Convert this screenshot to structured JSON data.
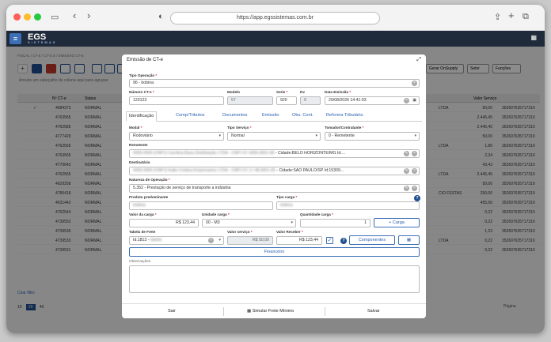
{
  "browser": {
    "url": "https://app.egssistemas.com.br"
  },
  "app": {
    "logo": "EGS",
    "logo_sub": "SISTEMAS"
  },
  "bg": {
    "breadcrumb": "FISCAL  /  CT-E / CT-E.S  /  EMISSÃO CT-E",
    "hint": "Arraste um cabeçalho de coluna aqui para agrupar",
    "cols": {
      "nct": "Nº CT-e",
      "status": "Status",
      "valor": "Valor Serviço"
    },
    "right_btns": {
      "onsupply": "Gerar OnSupply",
      "setor": "Setor",
      "funcoes": "Funções"
    },
    "rows": [
      {
        "n": "4684373",
        "s": "NORMAL",
        "c": "LTDA",
        "v": "50,00",
        "k": "352607635717310"
      },
      {
        "n": "4763565",
        "s": "NORMAL",
        "c": "",
        "v": "2.445,45",
        "k": "352607635717310"
      },
      {
        "n": "4762585",
        "s": "NORMAL",
        "c": "",
        "v": "2.445,45",
        "k": "352607635717310"
      },
      {
        "n": "4777429",
        "s": "NORMAL",
        "c": "",
        "v": "50,00",
        "k": "352607635717310"
      },
      {
        "n": "4762565",
        "s": "NORMAL",
        "c": "LTDA",
        "v": "1,80",
        "k": "352607635717310"
      },
      {
        "n": "4763565",
        "s": "NORMAL",
        "c": "",
        "v": "2,34",
        "k": "352607635717310"
      },
      {
        "n": "4770643",
        "s": "NORMAL",
        "c": "",
        "v": "43,43",
        "k": "352607635717310"
      },
      {
        "n": "4762565",
        "s": "NORMAL",
        "c": "LTDA",
        "v": "2.445,45",
        "k": "352607635717310"
      },
      {
        "n": "4629258",
        "s": "NORMAL",
        "c": "",
        "v": "50,00",
        "k": "352607635717310"
      },
      {
        "n": "4785418",
        "s": "NORMAL",
        "c": "CIO FESTAS",
        "v": "250,00",
        "k": "352607635717310"
      },
      {
        "n": "4631443",
        "s": "NORMAL",
        "c": "",
        "v": "455,56",
        "k": "352607635717310"
      },
      {
        "n": "4762544",
        "s": "NORMAL",
        "c": "",
        "v": "0,22",
        "k": "352607635717310"
      },
      {
        "n": "4739552",
        "s": "NORMAL",
        "c": "",
        "v": "0,22",
        "k": "352607635717310"
      },
      {
        "n": "4739535",
        "s": "NORMAL",
        "c": "",
        "v": "1,23",
        "k": "352607635717310"
      },
      {
        "n": "4739533",
        "s": "NORMAL",
        "c": "LTDA",
        "v": "0,22",
        "k": "352607635717310"
      },
      {
        "n": "4739531",
        "s": "NORMAL",
        "c": "",
        "v": "0,22",
        "k": "352607635717310"
      }
    ],
    "filter": "Criar filtro",
    "pages": [
      "10",
      "20",
      "40"
    ],
    "pages_right": "Página"
  },
  "modal": {
    "title": "Emissão de CT-e",
    "tipo_op": {
      "label": "Tipo Operação",
      "value": "96 - bobina"
    },
    "numero": {
      "label": "Número CT-e",
      "value": "123123"
    },
    "modelo": {
      "label": "Modelo",
      "value": "57"
    },
    "serie": {
      "label": "Serie",
      "value": "920"
    },
    "dv": {
      "label": "Dv",
      "value": "9"
    },
    "data": {
      "label": "Data Emissão",
      "value": "20/08/2026 14:41:03"
    },
    "tabs": [
      "Identificação",
      "Comp/Tributos",
      "Documentos",
      "Emissão",
      "Obs. Cont.",
      "Reforma Tributária"
    ],
    "modal_f": {
      "label": "Modal",
      "value": "Rodoviário"
    },
    "tipo_serv": {
      "label": "Tipo Serviço",
      "value": "Normal"
    },
    "tomador": {
      "label": "Tomador/Contratante",
      "value": "0 - Remetente"
    },
    "remetente": {
      "label": "Remetente",
      "value": "0000.0000 (CNPJ) Carolina Basa Distribuição LTDA - CNPJ 67.4356.0001-68",
      "suffix": "- Cidade:BELO HORIZONTE/MG Id:..."
    },
    "destinatario": {
      "label": "Destinatário",
      "value": "0000.0000 (CNPJ) Kalla Cristina Empresarios LTDA - CNPJ 07.17.48.0001-05",
      "suffix": "- Cidade:SAO PAULO/SP Id:15309..."
    },
    "natureza": {
      "label": "Natureza de Operação",
      "value": "5.352 - Prestação de serviço de transporte a indústria"
    },
    "produto": {
      "label": "Produto predominante",
      "value": "bobina"
    },
    "tipo_carga": {
      "label": "Tipo carga",
      "value": "bobina"
    },
    "valor_carga": {
      "label": "Valor da carga",
      "value": "R$ 123,44"
    },
    "unidade": {
      "label": "Unidade carga",
      "value": "00 - M3"
    },
    "quantidade": {
      "label": "Quantidade carga",
      "value": "1"
    },
    "btn_carga": "+ Carga",
    "tabela": {
      "label": "Tabela de Frete",
      "value": "Id.1813 - ",
      "value_blur": "tabela"
    },
    "valor_servico": {
      "label": "Valor serviço",
      "value": "R$ 50,00"
    },
    "valor_receber": {
      "label": "Valor Receber",
      "value": "R$ 123,44"
    },
    "btn_componentes": "Componentes",
    "btn_financeiro": "Financeiro",
    "obs": {
      "label": "Observações",
      "value": ""
    },
    "footer": {
      "sair": "Sair",
      "simular": "Simular Frete Mínimo",
      "salvar": "Salvar"
    }
  },
  "colors": {
    "primary": "#1e4f91",
    "link": "#2a62b5",
    "danger": "#d22"
  }
}
